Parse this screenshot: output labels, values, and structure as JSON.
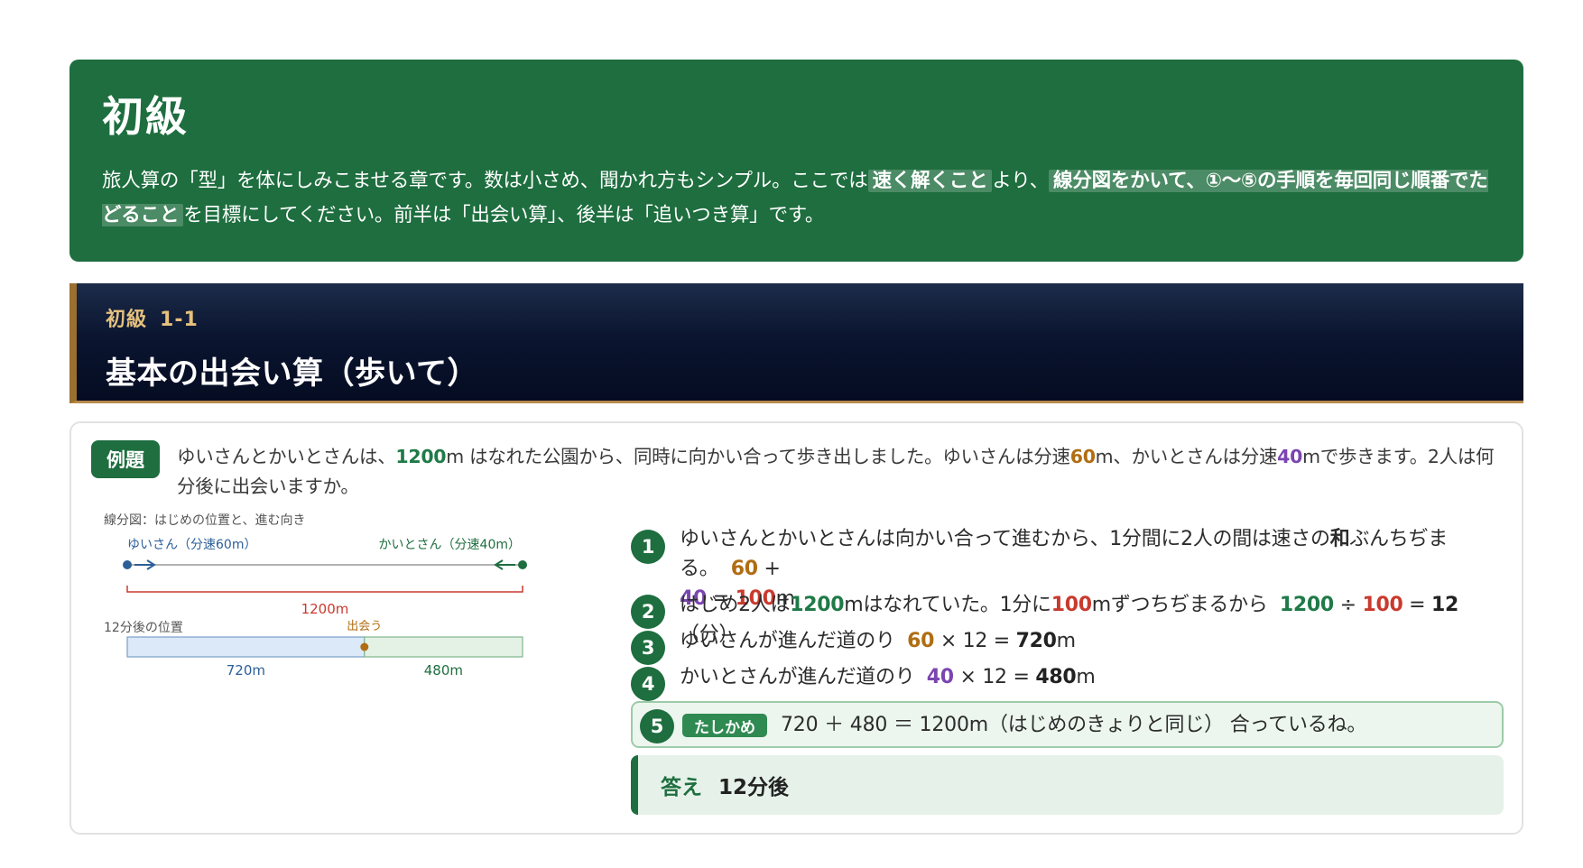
{
  "intro": {
    "title": "初級",
    "text_1": "旅人算の「型」を体にしみこませる章です。数は小さめ、聞かれ方もシンプル。ここでは",
    "highlight_1": "速く解くこと",
    "text_2": "より、",
    "highlight_2": "線分図をかいて、①〜⑤の手順を毎回同じ順番でたどること",
    "text_3": "を目標にしてください。前半は「出会い算」、後半は「追いつき算」です。"
  },
  "section": {
    "level": "初級",
    "number": "1-1",
    "title": "基本の出会い算（歩いて）"
  },
  "problem": {
    "badge": "例題",
    "t1": "ゆいさんとかいとさんは、",
    "distance": "1200",
    "t2": "m はなれた公園から、同時に向かい合って歩き出しました。ゆいさんは分速",
    "speed_a": "60",
    "t3": "m、かいとさんは分速",
    "speed_b": "40",
    "t4": "mで歩きます。2人は何分後に出会いますか。"
  },
  "diagram": {
    "caption": "線分図：はじめの位置と、進む向き",
    "person_a": "ゆいさん（分速60m）",
    "person_b": "かいとさん（分速40m）",
    "total": "1200m",
    "later_label": "12分後の位置",
    "meet_label": "出会う",
    "seg_a": "720m",
    "seg_b": "480m",
    "colors": {
      "a": "#2c5f98",
      "b": "#1e6e3f",
      "total": "#c93a2e",
      "meet": "#b06d12"
    },
    "meet_fraction": 0.6
  },
  "steps": {
    "s1": {
      "num": "1",
      "text": "ゆいさんとかいとさんは向かい合って進むから、1分間に2人の間は速さの",
      "bold": "和",
      "text2": "ぶんちぢまる。",
      "a": "60",
      "op": "+",
      "b": "40",
      "eq": "=",
      "result": "100",
      "unit": "m"
    },
    "s2": {
      "num": "2",
      "text": "はじめ2人は",
      "dist": "1200",
      "text2": "mはなれていた。1分に",
      "speed": "100",
      "text3": "mずつちぢまるから",
      "a": "1200",
      "op": "÷",
      "b": "100",
      "eq": "=",
      "result": "12",
      "unit": "（分）"
    },
    "s3": {
      "num": "3",
      "text": "ゆいさんが進んだ道のり",
      "a": "60",
      "op": "×",
      "b": "12",
      "eq": "=",
      "result": "720",
      "unit": "m"
    },
    "s4": {
      "num": "4",
      "text": "かいとさんが進んだ道のり",
      "a": "40",
      "op": "×",
      "b": "12",
      "eq": "=",
      "result": "480",
      "unit": "m"
    },
    "s5": {
      "num": "5",
      "tag": "たしかめ",
      "text": "720 ＋ 480 ＝ 1200m（はじめのきょりと同じ） 合っているね。"
    }
  },
  "answer": {
    "label": "答え",
    "value": "12分後"
  },
  "theme": {
    "green": "#1e6e3f",
    "navy": "#0b1530",
    "gold": "#b6894a"
  }
}
